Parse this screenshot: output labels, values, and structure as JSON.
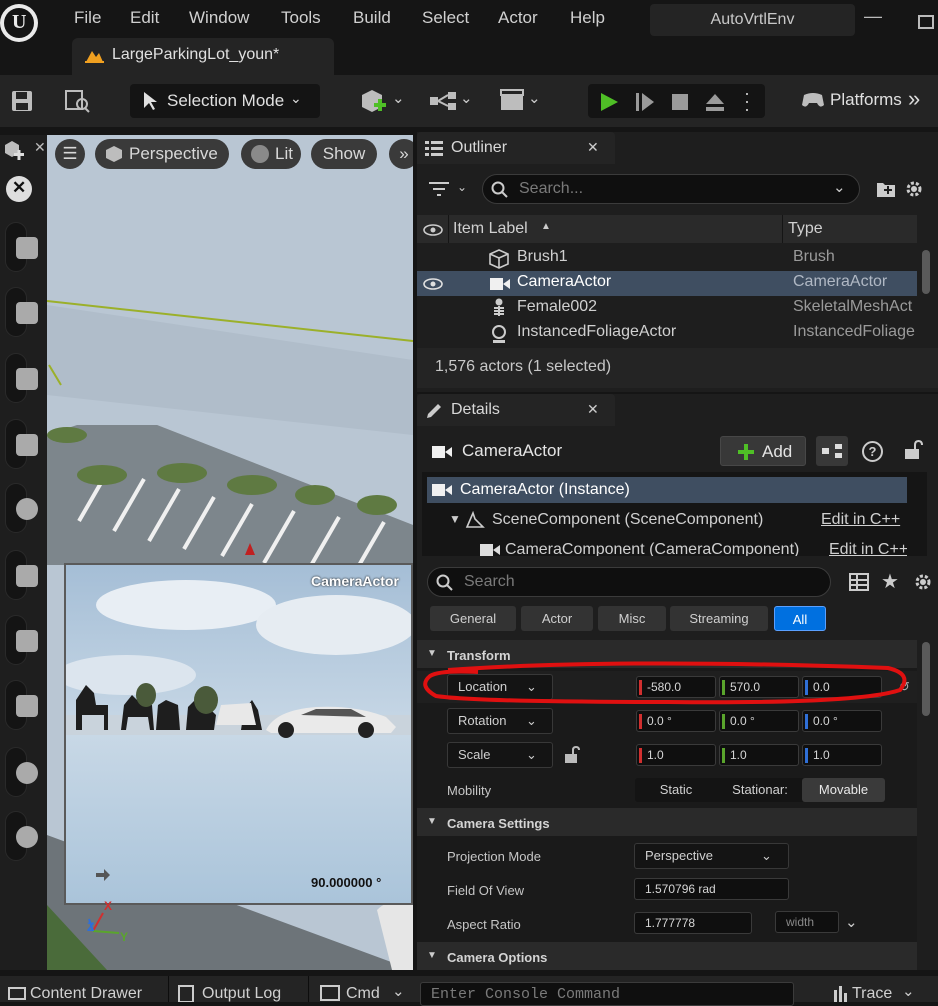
{
  "menu": {
    "items": [
      "File",
      "Edit",
      "Window",
      "Tools",
      "Build",
      "Select",
      "Actor",
      "Help"
    ],
    "project": "AutoVrtlEnv"
  },
  "level_tab": {
    "label": "LargeParkingLot_youn*"
  },
  "toolbar": {
    "selection_mode": "Selection Mode",
    "platforms": "Platforms"
  },
  "viewport": {
    "perspective": "Perspective",
    "lit": "Lit",
    "show": "Show",
    "camera_label": "CameraActor",
    "fov_readout": "90.000000 °",
    "axis_x": "X",
    "axis_y": "Y",
    "axis_z": "Z"
  },
  "outliner": {
    "title": "Outliner",
    "search_placeholder": "Search...",
    "col_label": "Item Label",
    "col_type": "Type",
    "rows": [
      {
        "label": "Brush1",
        "type": "Brush"
      },
      {
        "label": "CameraActor",
        "type": "CameraActor"
      },
      {
        "label": "Female002",
        "type": "SkeletalMeshAct"
      },
      {
        "label": "InstancedFoliageActor",
        "type": "InstancedFoliage"
      }
    ],
    "status": "1,576 actors (1 selected)"
  },
  "details": {
    "title": "Details",
    "actor_name": "CameraActor",
    "add_label": "Add",
    "components": [
      {
        "label": "CameraActor (Instance)"
      },
      {
        "label": "SceneComponent (SceneComponent)",
        "edit": "Edit in C++"
      },
      {
        "label": "CameraComponent (CameraComponent)",
        "edit": "Edit in C++"
      }
    ],
    "search_placeholder": "Search",
    "filters": [
      "General",
      "Actor",
      "Misc",
      "Streaming",
      "All"
    ],
    "transform": {
      "header": "Transform",
      "location_label": "Location",
      "location": [
        "-580.0",
        "570.0",
        "0.0"
      ],
      "rotation_label": "Rotation",
      "rotation": [
        "0.0 °",
        "0.0 °",
        "0.0 °"
      ],
      "scale_label": "Scale",
      "scale": [
        "1.0",
        "1.0",
        "1.0"
      ],
      "mobility_label": "Mobility",
      "mobility": [
        "Static",
        "Stationar:",
        "Movable"
      ]
    },
    "camera_settings": {
      "header": "Camera Settings",
      "projection_label": "Projection Mode",
      "projection_value": "Perspective",
      "fov_label": "Field Of View",
      "fov_value": "1.570796 rad",
      "aspect_label": "Aspect Ratio",
      "aspect_value": "1.777778",
      "aspect_extra": "width"
    },
    "camera_options": {
      "header": "Camera Options"
    }
  },
  "statusbar": {
    "content_drawer": "Content Drawer",
    "output_log": "Output Log",
    "cmd": "Cmd",
    "console_placeholder": "Enter Console Command",
    "trace": "Trace"
  },
  "colors": {
    "accent": "#0070e0",
    "x_axis": "#d12f2f",
    "y_axis": "#5aa52c",
    "z_axis": "#2f6fd6",
    "play": "#4fbf26",
    "annotation": "#e01010"
  }
}
